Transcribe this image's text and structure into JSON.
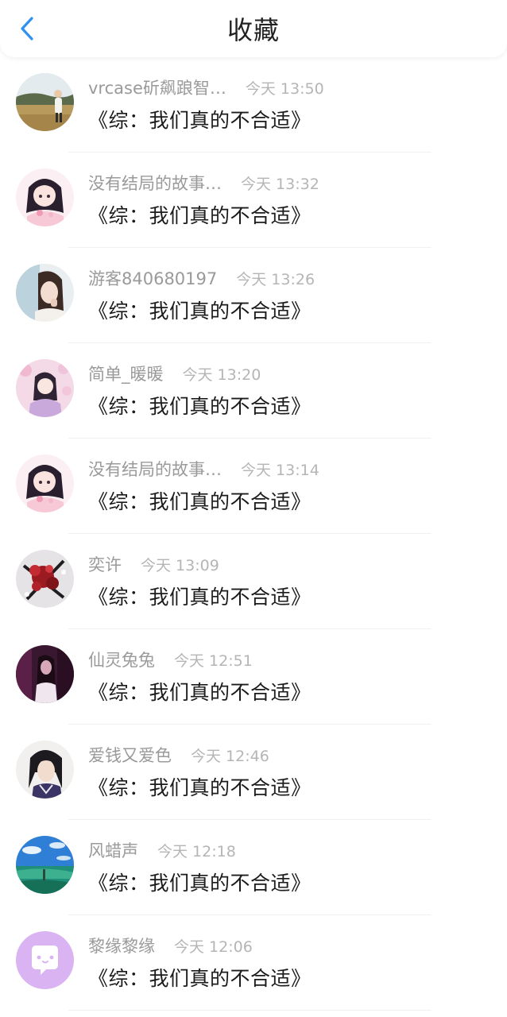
{
  "header": {
    "title": "收藏"
  },
  "colors": {
    "accent": "#2f8ff3",
    "name_text": "#9a9a9a",
    "time_text": "#b5b5b5",
    "content_text": "#1b1b1b"
  },
  "items": [
    {
      "name": "vrcase斫飙踉智…",
      "time": "今天 13:50",
      "content": "《综：我们真的不合适》",
      "avatar": "landscape-person-avatar"
    },
    {
      "name": "没有结局的故事…",
      "time": "今天 13:32",
      "content": "《综：我们真的不合适》",
      "avatar": "anime-girl-avatar"
    },
    {
      "name": "游客840680197",
      "time": "今天 13:26",
      "content": "《综：我们真的不合适》",
      "avatar": "girl-photo-avatar"
    },
    {
      "name": "简单_暖暖",
      "time": "今天 13:20",
      "content": "《综：我们真的不合适》",
      "avatar": "pink-blossom-avatar"
    },
    {
      "name": "没有结局的故事…",
      "time": "今天 13:14",
      "content": "《综：我们真的不合适》",
      "avatar": "anime-girl-avatar"
    },
    {
      "name": "奕许",
      "time": "今天 13:09",
      "content": "《综：我们真的不合适》",
      "avatar": "red-flowers-avatar"
    },
    {
      "name": "仙灵兔兔",
      "time": "今天 12:51",
      "content": "《综：我们真的不合适》",
      "avatar": "dark-purple-girl-avatar"
    },
    {
      "name": "爱钱又爱色",
      "time": "今天 12:46",
      "content": "《综：我们真的不合适》",
      "avatar": "ancient-hero-avatar"
    },
    {
      "name": "风蜡声",
      "time": "今天 12:18",
      "content": "《综：我们真的不合适》",
      "avatar": "sea-sky-avatar"
    },
    {
      "name": "黎缘黎缘",
      "time": "今天 12:06",
      "content": "《综：我们真的不合适》",
      "avatar": "default-chat-avatar"
    }
  ]
}
